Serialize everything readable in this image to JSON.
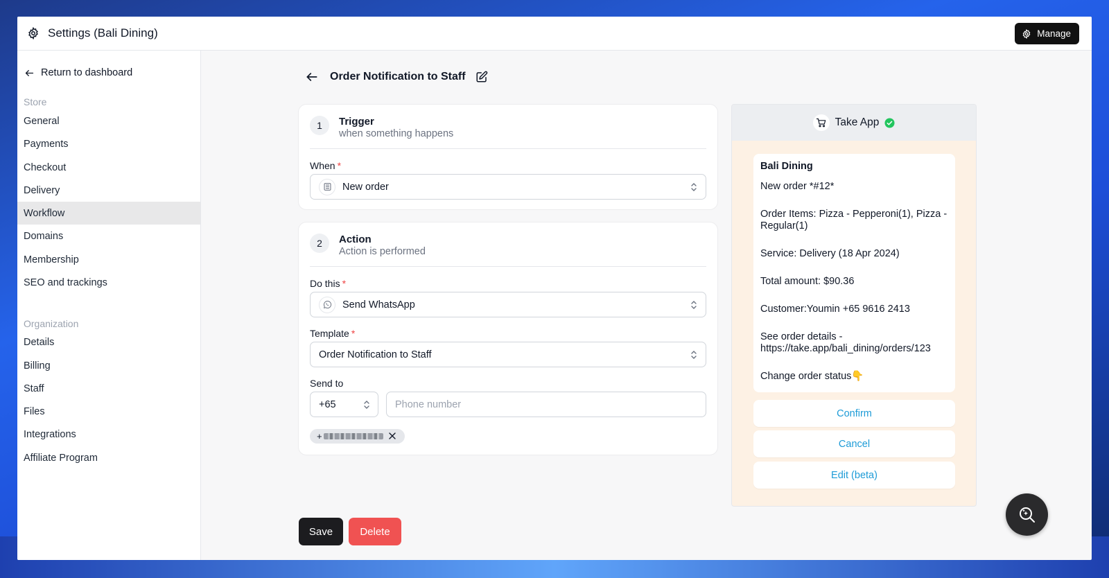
{
  "topbar": {
    "title": "Settings (Bali Dining)",
    "manage_label": "Manage"
  },
  "sidebar": {
    "return_label": "Return to dashboard",
    "store_title": "Store",
    "store_items": [
      "General",
      "Payments",
      "Checkout",
      "Delivery",
      "Workflow",
      "Domains",
      "Membership",
      "SEO and trackings"
    ],
    "active_item": "Workflow",
    "org_title": "Organization",
    "org_items": [
      "Details",
      "Billing",
      "Staff",
      "Files",
      "Integrations",
      "Affiliate Program"
    ]
  },
  "page": {
    "title": "Order Notification to Staff"
  },
  "trigger": {
    "number": "1",
    "title": "Trigger",
    "subtitle": "when something happens",
    "when_label": "When",
    "required_mark": "*",
    "when_value": "New order"
  },
  "action": {
    "number": "2",
    "title": "Action",
    "subtitle": "Action is performed",
    "do_label": "Do this",
    "do_value": "Send WhatsApp",
    "template_label": "Template",
    "template_value": "Order Notification to Staff",
    "send_to_label": "Send to",
    "country_code": "+65",
    "phone_placeholder": "Phone number",
    "recipient_prefix": "+"
  },
  "preview": {
    "app_name": "Take App",
    "sender": "Bali Dining",
    "lines": [
      "New order *#12*",
      "Order Items: Pizza - Pepperoni(1), Pizza - Regular(1)",
      "Service: Delivery (18 Apr 2024)",
      "Total amount: $90.36",
      "Customer:Youmin +65 9616 2413",
      "See order details - https://take.app/bali_dining/orders/123",
      "Change order status👇"
    ],
    "buttons": [
      "Confirm",
      "Cancel",
      "Edit (beta)"
    ]
  },
  "footer": {
    "save_label": "Save",
    "delete_label": "Delete"
  },
  "colors": {
    "accent_dark": "#1c1c1f",
    "danger": "#f05252",
    "whatsapp_link": "#1d9bd7",
    "verified": "#22c55e",
    "active_nav_bg": "#e8e8e9"
  },
  "icons": {
    "settings": "gear-icon",
    "back": "arrow-left-icon",
    "edit": "pencil-square-icon",
    "order": "list-document-icon",
    "whatsapp": "whatsapp-icon",
    "chevrons": "chevron-up-down-icon",
    "remove": "close-icon",
    "app_logo": "cart-icon",
    "verified": "check-badge-icon",
    "assistant": "search-sparkle-icon"
  }
}
